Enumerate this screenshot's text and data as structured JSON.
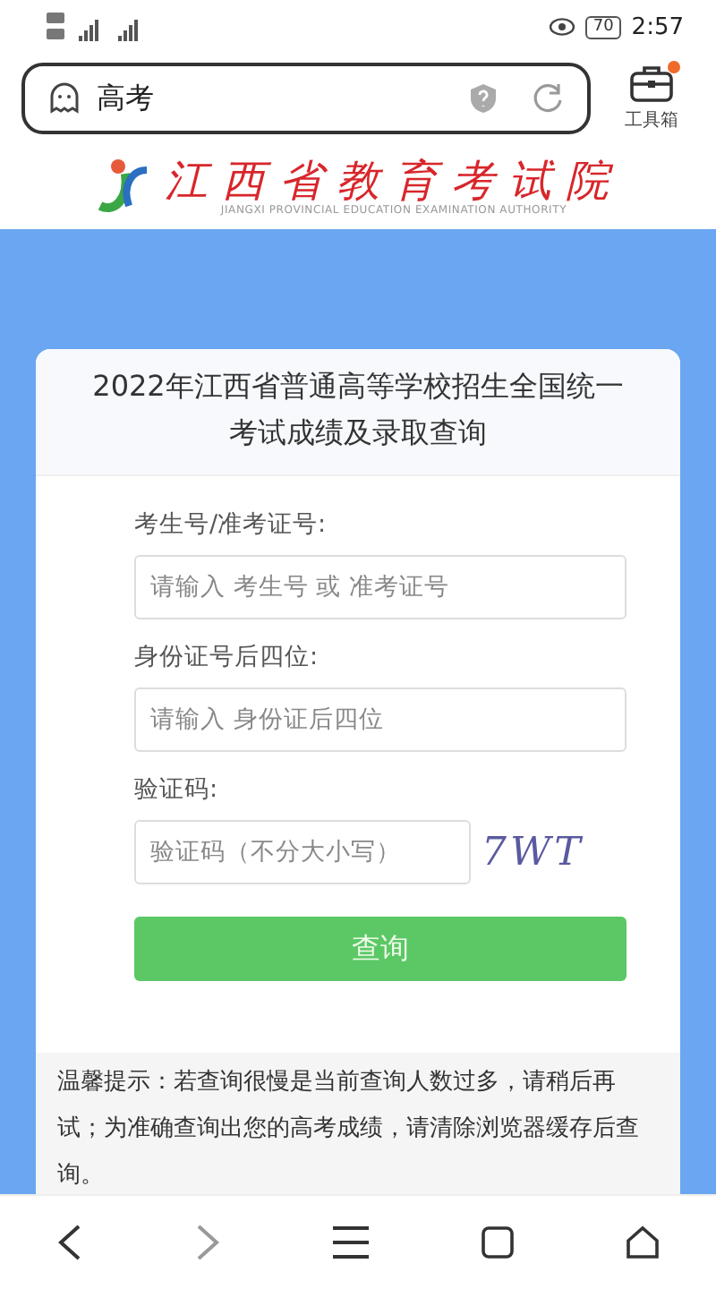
{
  "status_bar": {
    "battery": "70",
    "time": "2:57"
  },
  "address_bar": {
    "query": "高考",
    "toolbox_label": "工具箱",
    "toolbox_badge": true
  },
  "site_logo": {
    "title": "江西省教育考试院",
    "subtitle": "JIANGXI PROVINCIAL EDUCATION EXAMINATION AUTHORITY"
  },
  "card": {
    "title": "2022年江西省普通高等学校招生全国统一考试成绩及录取查询",
    "fields": [
      {
        "label": "考生号/准考证号:",
        "placeholder": "请输入 考生号 或 准考证号",
        "kind": "text"
      },
      {
        "label": "身份证号后四位:",
        "placeholder": "请输入 身份证后四位",
        "kind": "text"
      },
      {
        "label": "验证码:",
        "placeholder": "验证码（不分大小写）",
        "kind": "captcha",
        "captcha": "7WT"
      }
    ],
    "submit": "查询",
    "tip": "温馨提示：若查询很慢是当前查询人数过多，请稍后再试；为准确查询出您的高考成绩，请清除浏览器缓存后查询。"
  }
}
